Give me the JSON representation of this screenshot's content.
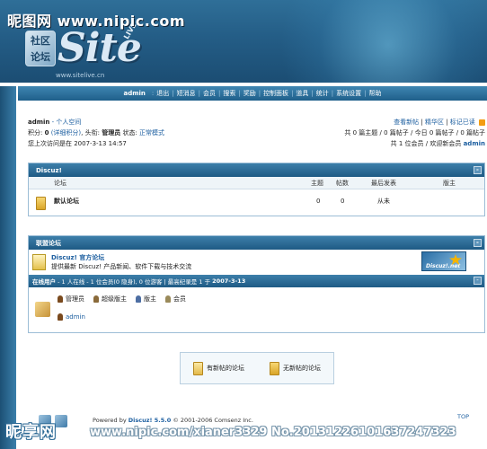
{
  "watermark": {
    "top_left": "昵图网 www.nipic.com",
    "bottom_left": "昵享网",
    "bottom": "www.nipic.com/xianer3329 No.20131226101637247323"
  },
  "logo": {
    "badge": "社区论坛",
    "site": "Site",
    "live": "LIVE",
    "url": "www.sitelive.cn"
  },
  "nav": {
    "user": "admin",
    "items": [
      "退出",
      "短消息",
      "会员",
      "搜索",
      "奖励",
      "控制面板",
      "道具",
      "统计",
      "系统设置",
      "帮助"
    ]
  },
  "user_info": {
    "name": "admin",
    "space_link": "- 个人空间",
    "points_label": "积分:",
    "points_value": "0",
    "detail": "(详细积分)",
    "title_label": "头衔:",
    "title_value": "管理员",
    "status_label": "状态:",
    "status_value": "正常模式",
    "last_visit": "您上次访问是在 2007-3-13 14:57"
  },
  "right_info": {
    "links": [
      "查看新帖",
      "精华区",
      "标记已读"
    ],
    "stats1": "共 0 篇主题 / 0 篇帖子 / 今日 0 篇帖子 / 0 篇帖子",
    "stats2_pre": "共 1 位会员 / 欢迎新会员",
    "stats2_user": "admin"
  },
  "category": {
    "title": "Discuz!",
    "toggle": "-",
    "headers": {
      "forum": "论坛",
      "topics": "主题",
      "posts": "帖数",
      "last": "最后发表",
      "mod": "版主"
    },
    "rows": [
      {
        "name": "默认论坛",
        "topics": "0",
        "posts": "0",
        "last": "从未",
        "mod": ""
      }
    ]
  },
  "league": {
    "title": "联盟论坛",
    "toggle": "-",
    "items": [
      {
        "name": "Discuz! 官方论坛",
        "desc": "提供最新 Discuz! 产品新闻、软件下载与技术交流",
        "banner": "Discuz!.net"
      }
    ]
  },
  "online": {
    "prefix": "在线用户",
    "line": "- 1 人在线 - 1 位会员(0 隐身), 0 位游客 | 最高纪录是 1 于",
    "date": "2007-3-13",
    "toggle": "-",
    "legend": [
      {
        "label": "管理员",
        "color": "#7a4a1e"
      },
      {
        "label": "超级版主",
        "color": "#8a6a3a"
      },
      {
        "label": "版主",
        "color": "#4d6ea3"
      },
      {
        "label": "会员",
        "color": "#9a8a5a"
      }
    ],
    "users": [
      "admin"
    ]
  },
  "legend_box": {
    "new": "有新帖的论坛",
    "none": "无新帖的论坛"
  },
  "footer": {
    "powered": "Powered by",
    "product": "Discuz! 5.5.0",
    "copyright": "© 2001-2006 Comsenz Inc.",
    "top": "TOP"
  },
  "colors": {
    "header": "#245d86",
    "accent": "#1d5fa0",
    "panel_border": "#9cbdd6"
  }
}
